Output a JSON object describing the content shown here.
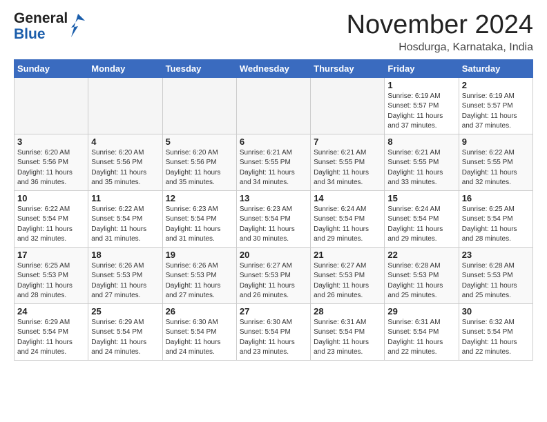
{
  "header": {
    "logo_general": "General",
    "logo_blue": "Blue",
    "month_title": "November 2024",
    "location": "Hosdurga, Karnataka, India"
  },
  "weekdays": [
    "Sunday",
    "Monday",
    "Tuesday",
    "Wednesday",
    "Thursday",
    "Friday",
    "Saturday"
  ],
  "weeks": [
    [
      {
        "day": "",
        "info": ""
      },
      {
        "day": "",
        "info": ""
      },
      {
        "day": "",
        "info": ""
      },
      {
        "day": "",
        "info": ""
      },
      {
        "day": "",
        "info": ""
      },
      {
        "day": "1",
        "info": "Sunrise: 6:19 AM\nSunset: 5:57 PM\nDaylight: 11 hours\nand 37 minutes."
      },
      {
        "day": "2",
        "info": "Sunrise: 6:19 AM\nSunset: 5:57 PM\nDaylight: 11 hours\nand 37 minutes."
      }
    ],
    [
      {
        "day": "3",
        "info": "Sunrise: 6:20 AM\nSunset: 5:56 PM\nDaylight: 11 hours\nand 36 minutes."
      },
      {
        "day": "4",
        "info": "Sunrise: 6:20 AM\nSunset: 5:56 PM\nDaylight: 11 hours\nand 35 minutes."
      },
      {
        "day": "5",
        "info": "Sunrise: 6:20 AM\nSunset: 5:56 PM\nDaylight: 11 hours\nand 35 minutes."
      },
      {
        "day": "6",
        "info": "Sunrise: 6:21 AM\nSunset: 5:55 PM\nDaylight: 11 hours\nand 34 minutes."
      },
      {
        "day": "7",
        "info": "Sunrise: 6:21 AM\nSunset: 5:55 PM\nDaylight: 11 hours\nand 34 minutes."
      },
      {
        "day": "8",
        "info": "Sunrise: 6:21 AM\nSunset: 5:55 PM\nDaylight: 11 hours\nand 33 minutes."
      },
      {
        "day": "9",
        "info": "Sunrise: 6:22 AM\nSunset: 5:55 PM\nDaylight: 11 hours\nand 32 minutes."
      }
    ],
    [
      {
        "day": "10",
        "info": "Sunrise: 6:22 AM\nSunset: 5:54 PM\nDaylight: 11 hours\nand 32 minutes."
      },
      {
        "day": "11",
        "info": "Sunrise: 6:22 AM\nSunset: 5:54 PM\nDaylight: 11 hours\nand 31 minutes."
      },
      {
        "day": "12",
        "info": "Sunrise: 6:23 AM\nSunset: 5:54 PM\nDaylight: 11 hours\nand 31 minutes."
      },
      {
        "day": "13",
        "info": "Sunrise: 6:23 AM\nSunset: 5:54 PM\nDaylight: 11 hours\nand 30 minutes."
      },
      {
        "day": "14",
        "info": "Sunrise: 6:24 AM\nSunset: 5:54 PM\nDaylight: 11 hours\nand 29 minutes."
      },
      {
        "day": "15",
        "info": "Sunrise: 6:24 AM\nSunset: 5:54 PM\nDaylight: 11 hours\nand 29 minutes."
      },
      {
        "day": "16",
        "info": "Sunrise: 6:25 AM\nSunset: 5:54 PM\nDaylight: 11 hours\nand 28 minutes."
      }
    ],
    [
      {
        "day": "17",
        "info": "Sunrise: 6:25 AM\nSunset: 5:53 PM\nDaylight: 11 hours\nand 28 minutes."
      },
      {
        "day": "18",
        "info": "Sunrise: 6:26 AM\nSunset: 5:53 PM\nDaylight: 11 hours\nand 27 minutes."
      },
      {
        "day": "19",
        "info": "Sunrise: 6:26 AM\nSunset: 5:53 PM\nDaylight: 11 hours\nand 27 minutes."
      },
      {
        "day": "20",
        "info": "Sunrise: 6:27 AM\nSunset: 5:53 PM\nDaylight: 11 hours\nand 26 minutes."
      },
      {
        "day": "21",
        "info": "Sunrise: 6:27 AM\nSunset: 5:53 PM\nDaylight: 11 hours\nand 26 minutes."
      },
      {
        "day": "22",
        "info": "Sunrise: 6:28 AM\nSunset: 5:53 PM\nDaylight: 11 hours\nand 25 minutes."
      },
      {
        "day": "23",
        "info": "Sunrise: 6:28 AM\nSunset: 5:53 PM\nDaylight: 11 hours\nand 25 minutes."
      }
    ],
    [
      {
        "day": "24",
        "info": "Sunrise: 6:29 AM\nSunset: 5:54 PM\nDaylight: 11 hours\nand 24 minutes."
      },
      {
        "day": "25",
        "info": "Sunrise: 6:29 AM\nSunset: 5:54 PM\nDaylight: 11 hours\nand 24 minutes."
      },
      {
        "day": "26",
        "info": "Sunrise: 6:30 AM\nSunset: 5:54 PM\nDaylight: 11 hours\nand 24 minutes."
      },
      {
        "day": "27",
        "info": "Sunrise: 6:30 AM\nSunset: 5:54 PM\nDaylight: 11 hours\nand 23 minutes."
      },
      {
        "day": "28",
        "info": "Sunrise: 6:31 AM\nSunset: 5:54 PM\nDaylight: 11 hours\nand 23 minutes."
      },
      {
        "day": "29",
        "info": "Sunrise: 6:31 AM\nSunset: 5:54 PM\nDaylight: 11 hours\nand 22 minutes."
      },
      {
        "day": "30",
        "info": "Sunrise: 6:32 AM\nSunset: 5:54 PM\nDaylight: 11 hours\nand 22 minutes."
      }
    ]
  ]
}
